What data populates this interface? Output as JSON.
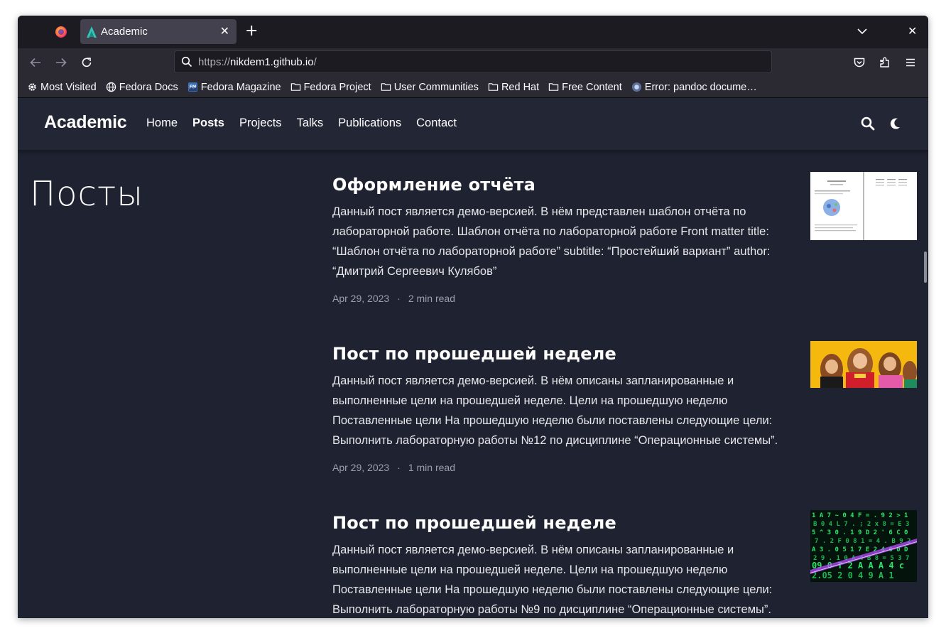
{
  "browser": {
    "tab_title": "Academic",
    "url_prefix": "https://",
    "url_host": "nikdem1.github.io",
    "url_path": "/",
    "bookmarks": [
      "Most Visited",
      "Fedora Docs",
      "Fedora Magazine",
      "Fedora Project",
      "User Communities",
      "Red Hat",
      "Free Content",
      "Error: pandoc docume…"
    ]
  },
  "site": {
    "brand": "Academic",
    "menu": [
      "Home",
      "Posts",
      "Projects",
      "Talks",
      "Publications",
      "Contact"
    ],
    "active_menu": "Posts"
  },
  "page": {
    "title": "Посты",
    "posts": [
      {
        "title": "Оформление отчёта",
        "summary": "Данный пост является демо-версией. В нём представлен шаблон отчёта по лабораторной работе. Шаблон отчёта по лабораторной работе Front matter title: “Шаблон отчёта по лабораторной работе” subtitle: “Простейший вариант” author: “Дмитрий Сергеевич Кулябов”",
        "date": "Apr 29, 2023",
        "read_time": "2 min read",
        "thumb": "report-document-thumbnail"
      },
      {
        "title": "Пост по прошедшей неделе",
        "summary": "Данный пост является демо-версией. В нём описаны запланированные и выполненные цели на прошедшей неделе. Цели на прошедшую неделю Поставленные цели На прошедшую неделю были поставлены следующие цели: Выполнить лабораторную работы №12 по дисциплине “Операционные системы”.",
        "date": "Apr 29, 2023",
        "read_time": "1 min read",
        "thumb": "chipmunks-thumbnail"
      },
      {
        "title": "Пост по прошедшей неделе",
        "summary": "Данный пост является демо-версией. В нём описаны запланированные и выполненные цели на прошедшей неделе. Цели на прошедшую неделю Поставленные цели На прошедшую неделю были поставлены следующие цели: Выполнить лабораторную работы №9 по дисциплине “Операционные системы”.",
        "date": "",
        "read_time": "",
        "thumb": "green-code-matrix-thumbnail"
      }
    ]
  },
  "colors": {
    "page_bg": "#1f2230",
    "header_bg": "#232634",
    "browser_bg": "#1c1b22",
    "toolbar_bg": "#2b2a33",
    "tab_active_bg": "#42414d",
    "meta_text": "#9aa0ab"
  }
}
